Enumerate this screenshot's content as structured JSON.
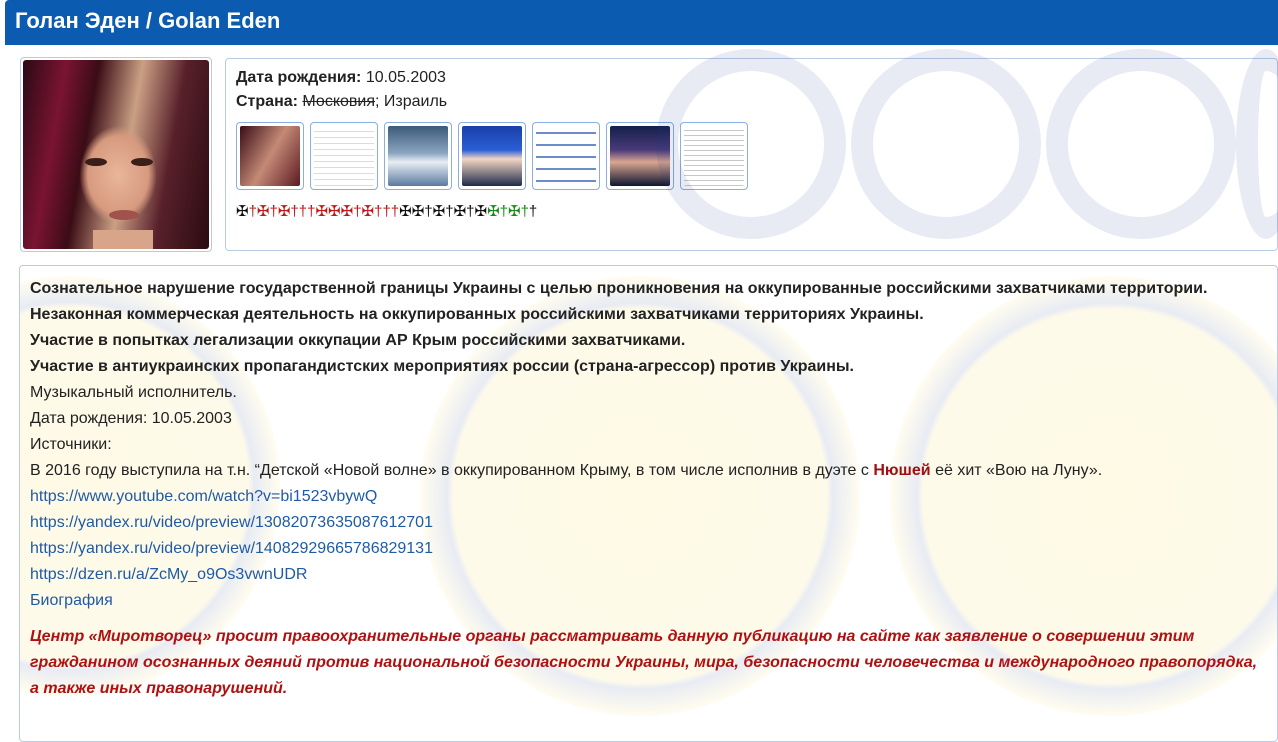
{
  "header": {
    "title": "Голан Эден / Golan Eden"
  },
  "profile": {
    "birth_label": "Дата рождения:",
    "birth_value": "10.05.2003",
    "country_label": "Страна:",
    "country_struck": "Московия",
    "country_rest": "; Израиль",
    "crosses": [
      "✠",
      "†",
      "✠",
      "†",
      "✠",
      "†",
      "†",
      "†",
      "✠",
      "✠",
      "✠",
      "†",
      "✠",
      "†",
      "†",
      "†",
      "✠",
      "✠",
      "†",
      "✠",
      "†",
      "✠",
      "†",
      "✠",
      "✠",
      "†",
      "✠",
      "†",
      "†"
    ],
    "cross_colors": [
      "k",
      "r",
      "r",
      "r",
      "r",
      "r",
      "r",
      "r",
      "r",
      "r",
      "r",
      "r",
      "r",
      "r",
      "r",
      "r",
      "k",
      "k",
      "k",
      "k",
      "k",
      "k",
      "k",
      "k",
      "g",
      "g",
      "g",
      "g",
      "k"
    ]
  },
  "main": {
    "accusations": [
      "Сознательное нарушение государственной границы Украины с целью проникновения на оккупированные российскими захватчиками территории.",
      "Незаконная коммерческая деятельность на оккупированных российскими захватчиками территориях Украины.",
      "Участие в попытках легализации оккупации АР Крым российскими захватчиками.",
      "Участие в антиукраинских пропагандистских мероприятиях россии (страна-агрессор) против Украины."
    ],
    "occupation": "Музыкальный исполнитель.",
    "birth_line": "Дата рождения: 10.05.2003",
    "sources_label": "Источники:",
    "story_start": "В 2016 году выступила на т.н. “Детской «Новой волне» в оккупированном Крыму, в том числе исполнив в дуэте с ",
    "story_name": "Нюшей",
    "story_end": " её хит «Вою на Луну».",
    "links": [
      "https://www.youtube.com/watch?v=bi1523vbywQ",
      "https://yandex.ru/video/preview/13082073635087612701",
      "https://yandex.ru/video/preview/14082929665786829131",
      "https://dzen.ru/a/ZcMy_o9Os3vwnUDR",
      "Биография"
    ],
    "appeal": "Центр «Миротворец» просит правоохранительные органы рассматривать данную публикацию на сайте как заявление о совершении этим гражданином осознанных деяний против национальной безопасности Украины, мира, безопасности человечества и международного правопорядка, а также иных правонарушений."
  },
  "colors": {
    "header_bg": "#0b5cb0",
    "link": "#1f5aa6",
    "appeal": "#b01010"
  }
}
